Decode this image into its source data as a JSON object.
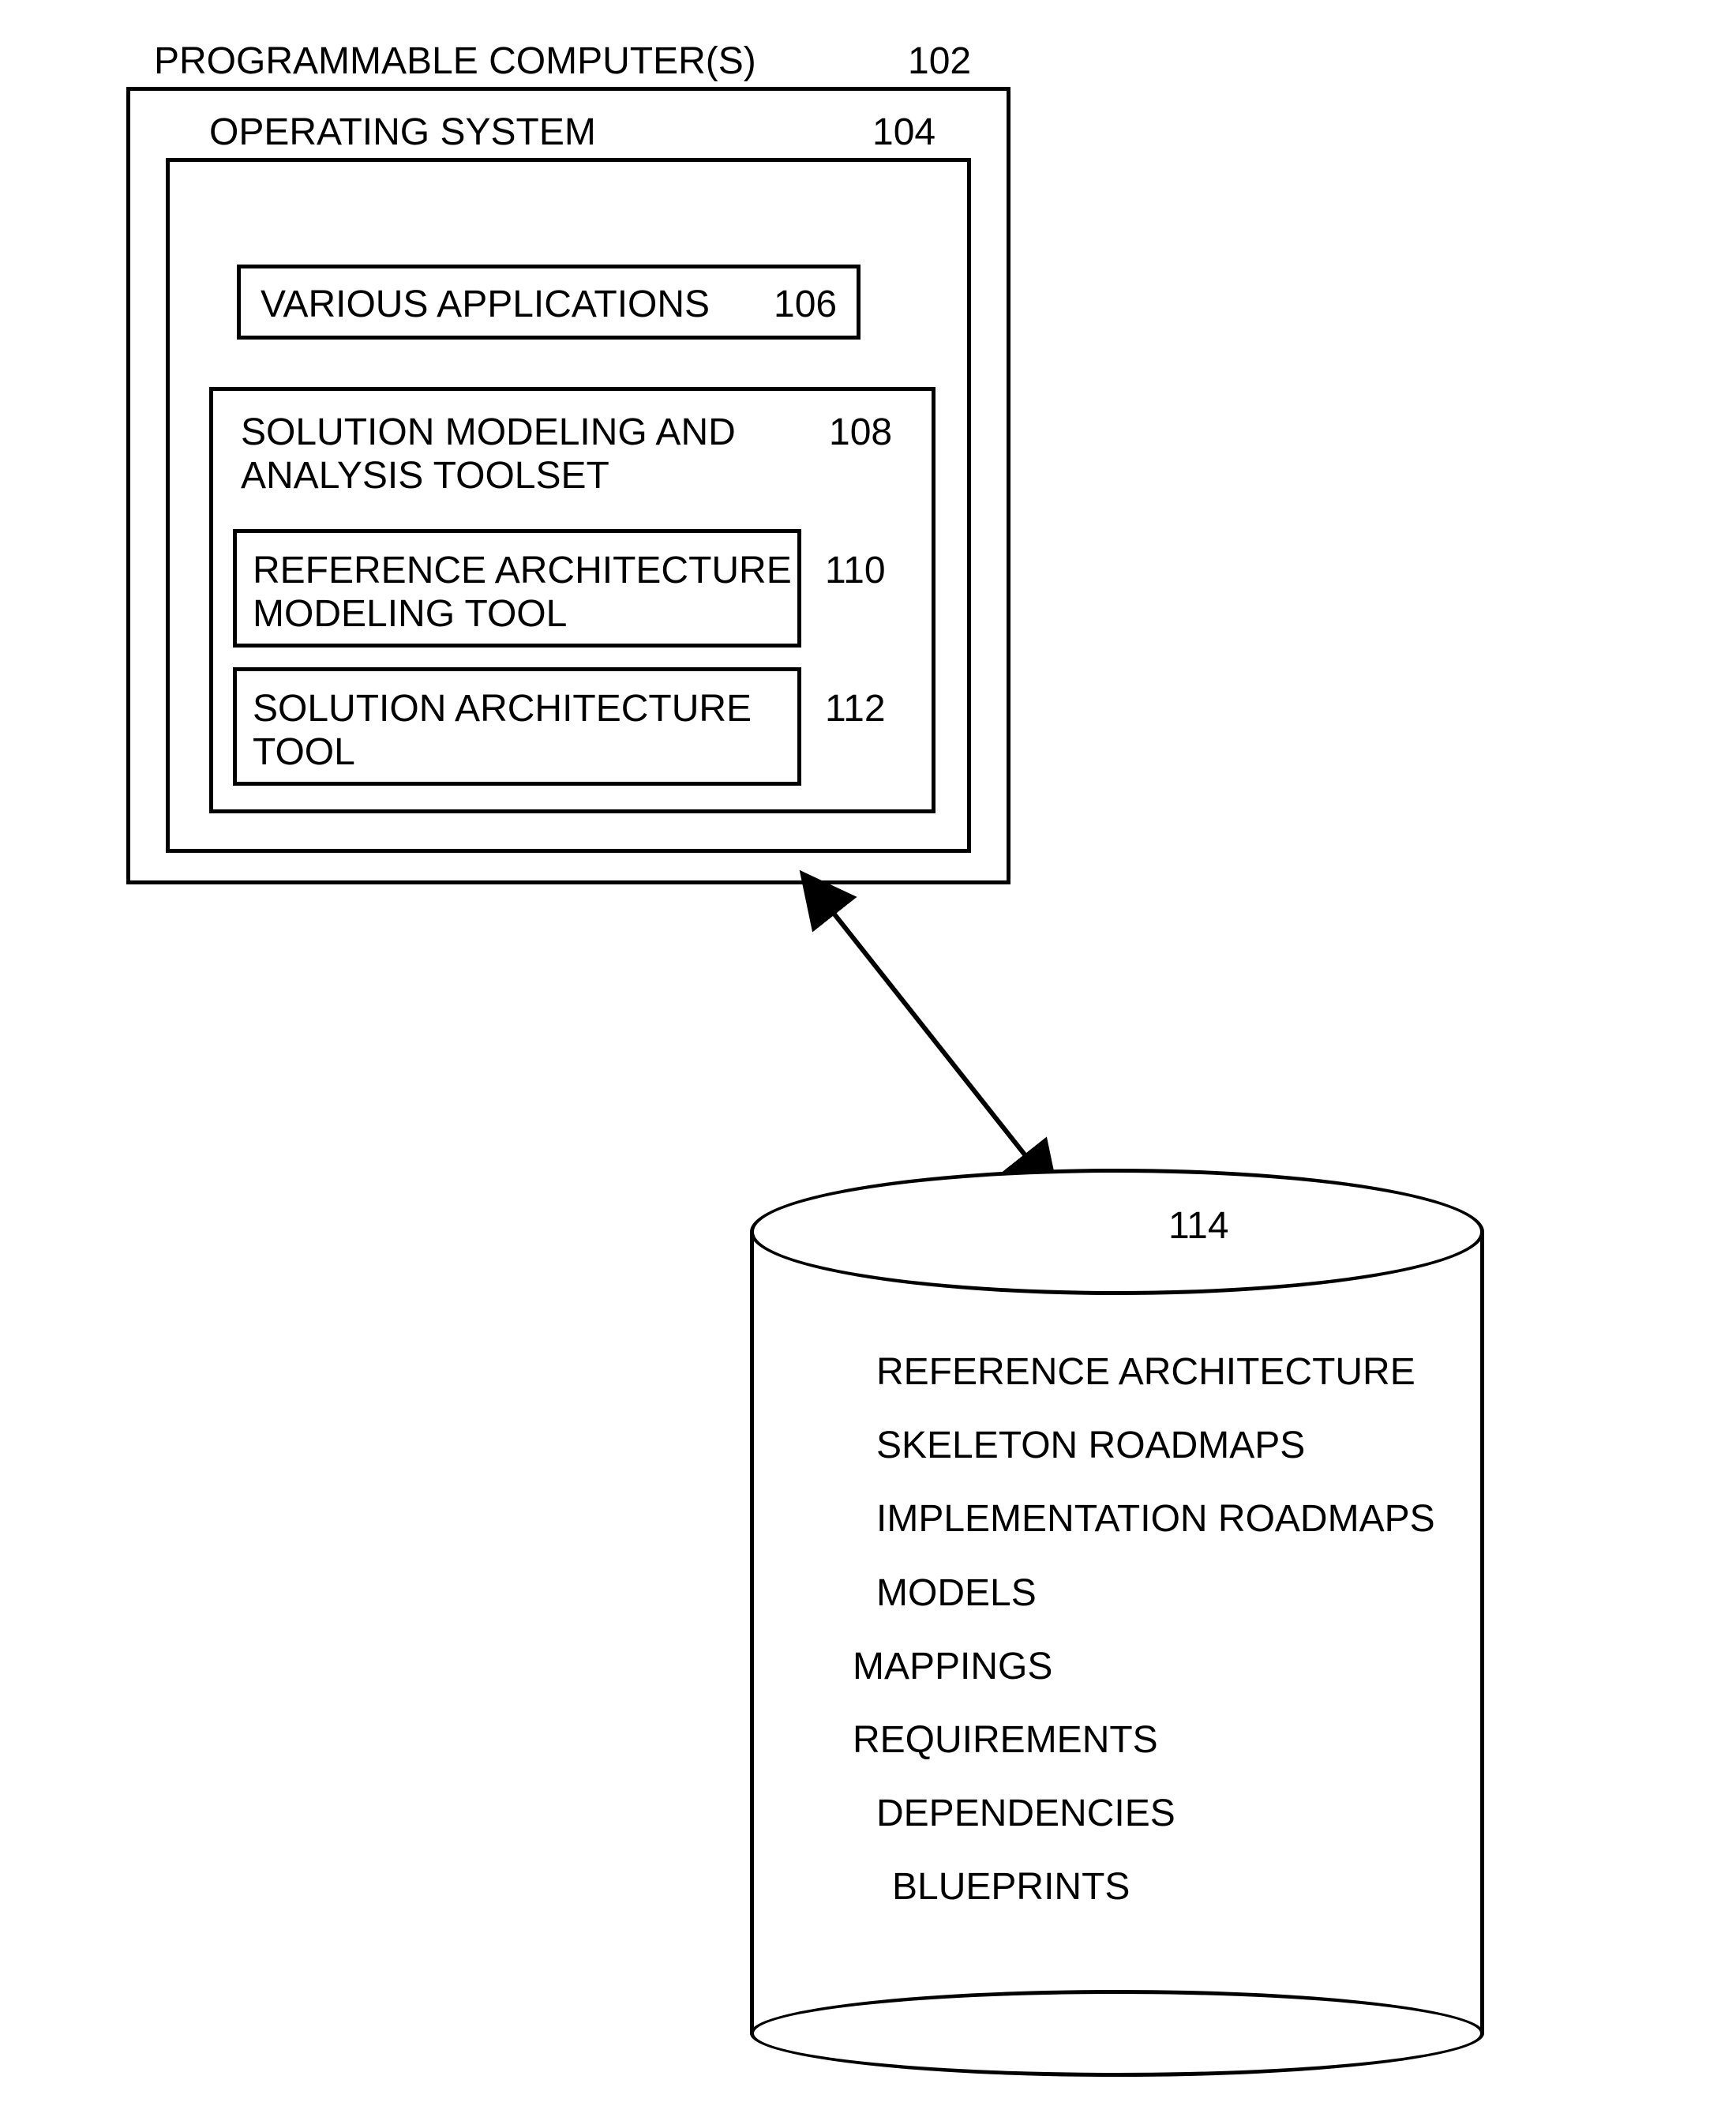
{
  "computer": {
    "title": "PROGRAMMABLE COMPUTER(S)",
    "ref": "102"
  },
  "os": {
    "title": "OPERATING SYSTEM",
    "ref": "104"
  },
  "apps": {
    "title": "VARIOUS APPLICATIONS",
    "ref": "106"
  },
  "toolset": {
    "title": "SOLUTION MODELING AND\nANALYSIS TOOLSET",
    "ref": "108"
  },
  "ref_arch_tool": {
    "title": "REFERENCE ARCHITECTURE\nMODELING TOOL",
    "ref": "110"
  },
  "sol_arch_tool": {
    "title": "SOLUTION ARCHITECTURE\nTOOL",
    "ref": "112"
  },
  "datastore": {
    "ref": "114",
    "items": [
      "REFERENCE\nARCHITECTURE",
      "SKELETON ROADMAPS",
      "IMPLEMENTATION\nROADMAPS",
      "MODELS",
      "MAPPINGS",
      "REQUIREMENTS",
      "DEPENDENCIES",
      "BLUEPRINTS"
    ]
  }
}
